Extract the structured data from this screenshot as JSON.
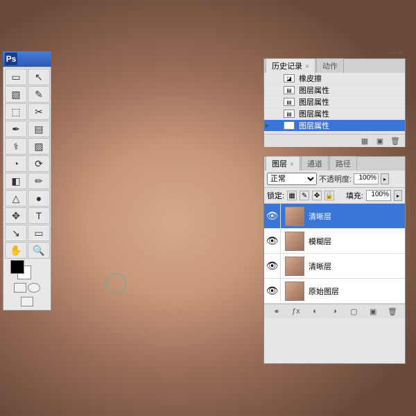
{
  "app": {
    "logo": "Ps"
  },
  "history": {
    "tabs": [
      {
        "label": "历史记录",
        "active": true
      },
      {
        "label": "动作",
        "active": false
      }
    ],
    "items": [
      {
        "label": "橡皮擦",
        "selected": false,
        "iconType": "eraser"
      },
      {
        "label": "图层属性",
        "selected": false,
        "iconType": "doc"
      },
      {
        "label": "图层属性",
        "selected": false,
        "iconType": "doc"
      },
      {
        "label": "图层属性",
        "selected": false,
        "iconType": "doc"
      },
      {
        "label": "图层属性",
        "selected": true,
        "iconType": "doc",
        "marker": "▹"
      }
    ]
  },
  "layers": {
    "tabs": [
      {
        "label": "图层",
        "active": true
      },
      {
        "label": "通道",
        "active": false
      },
      {
        "label": "路径",
        "active": false
      }
    ],
    "blendMode": "正常",
    "opacityLabel": "不透明度:",
    "opacityValue": "100%",
    "lockLabel": "锁定:",
    "fillLabel": "填充:",
    "fillValue": "100%",
    "items": [
      {
        "name": "清晰层",
        "selected": true,
        "visible": true
      },
      {
        "name": "模糊层",
        "selected": false,
        "visible": true
      },
      {
        "name": "清晰层",
        "selected": false,
        "visible": true
      },
      {
        "name": "原始图层",
        "selected": false,
        "visible": true
      }
    ]
  },
  "tools": [
    "▭",
    "↖",
    "▧",
    "✎",
    "⬚",
    "✂",
    "✒",
    "▤",
    "⚕",
    "▨",
    "◔",
    "⟳",
    "◧",
    "✏",
    "△",
    "⌫",
    "⬓",
    "●",
    "✥",
    "T",
    "↘",
    "▭",
    "◢",
    "⚲",
    "✋",
    "🔍"
  ]
}
